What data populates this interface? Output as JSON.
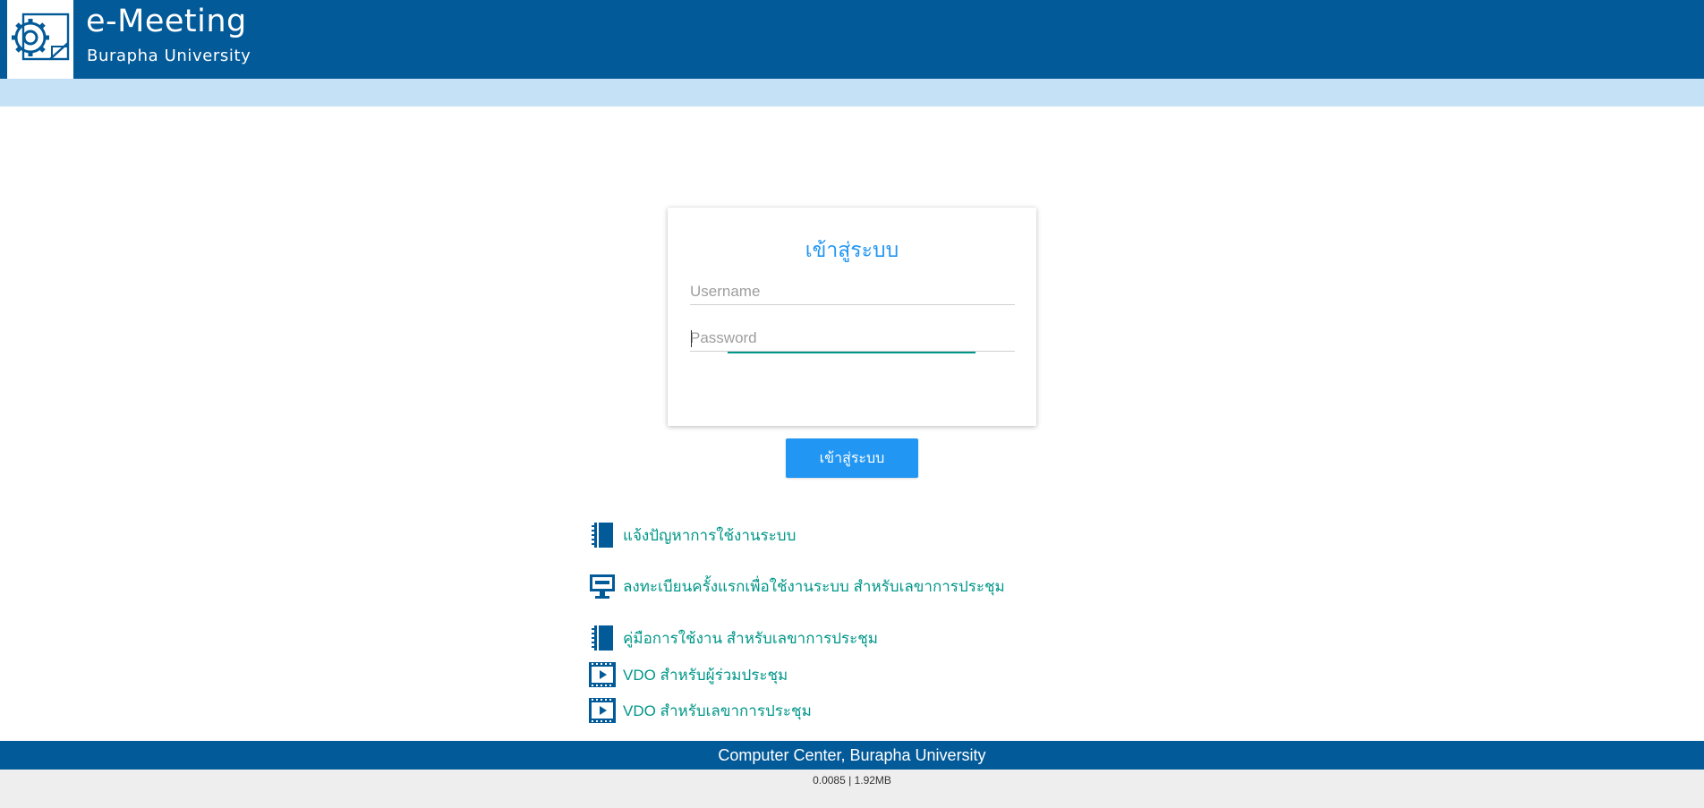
{
  "header": {
    "title": "e-Meeting",
    "subtitle": "Burapha University",
    "logo_icon": "gear-document-icon",
    "background": "#035a99"
  },
  "login": {
    "title": "เข้าสู่ระบบ",
    "username_placeholder": "Username",
    "username_value": "",
    "password_placeholder": "Password",
    "password_value": "",
    "submit_label": "เข้าสู่ระบบ",
    "accent_color": "#2196f3",
    "focus_color": "#009688"
  },
  "links": [
    {
      "label": "แจ้งปัญหาการใช้งานระบบ",
      "icon": "notebook-icon"
    },
    {
      "label": "ลงทะเบียนครั้งแรกเพื่อใช้งานระบบ สำหรับเลขาการประชุม",
      "icon": "monitor-icon"
    },
    {
      "label": "คู่มือการใช้งาน สำหรับเลขาการประชุม",
      "icon": "notebook-icon"
    },
    {
      "label": "VDO สำหรับผู้ร่วมประชุม",
      "icon": "video-icon"
    },
    {
      "label": "VDO สำหรับเลขาการประชุม",
      "icon": "video-icon"
    }
  ],
  "footer": {
    "text": "Computer Center, Burapha University",
    "stats": "0.0085 | 1.92MB"
  }
}
